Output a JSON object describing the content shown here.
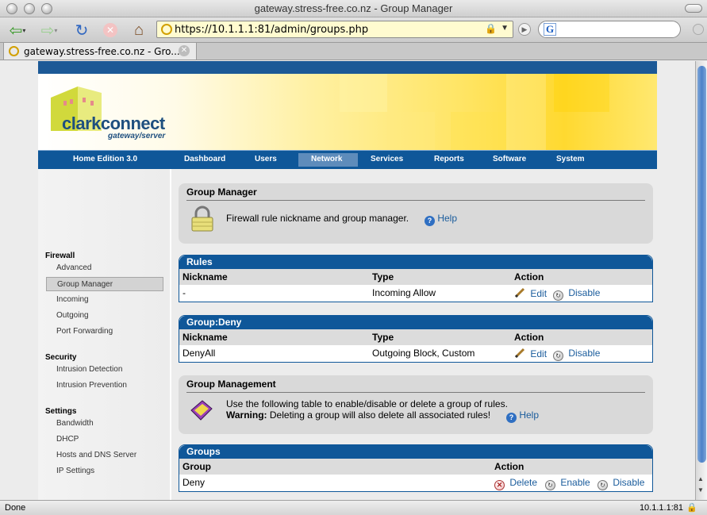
{
  "window": {
    "title": "gateway.stress-free.co.nz - Group Manager"
  },
  "toolbar": {
    "url": "https://10.1.1.1:81/admin/groups.php",
    "search_value": "",
    "search_engine_icon": "google-icon"
  },
  "tab": {
    "title": "gateway.stress-free.co.nz - Gro..."
  },
  "header": {
    "logo_name": "clarkconnect",
    "logo_sub": "gateway/server"
  },
  "nav": {
    "edition": "Home Edition 3.0",
    "items": [
      "Dashboard",
      "Users",
      "Network",
      "Services",
      "Reports",
      "Software",
      "System"
    ],
    "active": "Network"
  },
  "sidebar": {
    "groups": [
      {
        "title": "Firewall",
        "items": [
          "Advanced",
          "Group Manager",
          "Incoming",
          "Outgoing",
          "Port Forwarding"
        ]
      },
      {
        "title": "Security",
        "items": [
          "Intrusion Detection",
          "Intrusion Prevention"
        ]
      },
      {
        "title": "Settings",
        "items": [
          "Bandwidth",
          "DHCP",
          "Hosts and DNS Server",
          "IP Settings"
        ]
      }
    ],
    "active_item": "Group Manager"
  },
  "group_manager": {
    "title": "Group Manager",
    "description": "Firewall rule nickname and group manager.",
    "help": "Help"
  },
  "rules": {
    "title": "Rules",
    "columns": [
      "Nickname",
      "Type",
      "Action"
    ],
    "rows": [
      {
        "nickname": "-",
        "type": "Incoming Allow",
        "edit": "Edit",
        "disable": "Disable"
      }
    ]
  },
  "group_deny": {
    "title": "Group:Deny",
    "columns": [
      "Nickname",
      "Type",
      "Action"
    ],
    "rows": [
      {
        "nickname": "DenyAll",
        "type": "Outgoing Block, Custom",
        "edit": "Edit",
        "disable": "Disable"
      }
    ]
  },
  "group_management": {
    "title": "Group Management",
    "line1": "Use the following table to enable/disable or delete a group of rules.",
    "warning_label": "Warning:",
    "warning_text": "Deleting a group will also delete all associated rules!",
    "help": "Help"
  },
  "groups": {
    "title": "Groups",
    "columns": [
      "Group",
      "Action"
    ],
    "rows": [
      {
        "group": "Deny",
        "delete": "Delete",
        "enable": "Enable",
        "disable": "Disable"
      }
    ]
  },
  "status": {
    "left": "Done",
    "right": "10.1.1.1:81"
  },
  "colors": {
    "nav_blue": "#0f5799",
    "link_blue": "#1a5c9c",
    "banner_yellow": "#ffd930"
  }
}
